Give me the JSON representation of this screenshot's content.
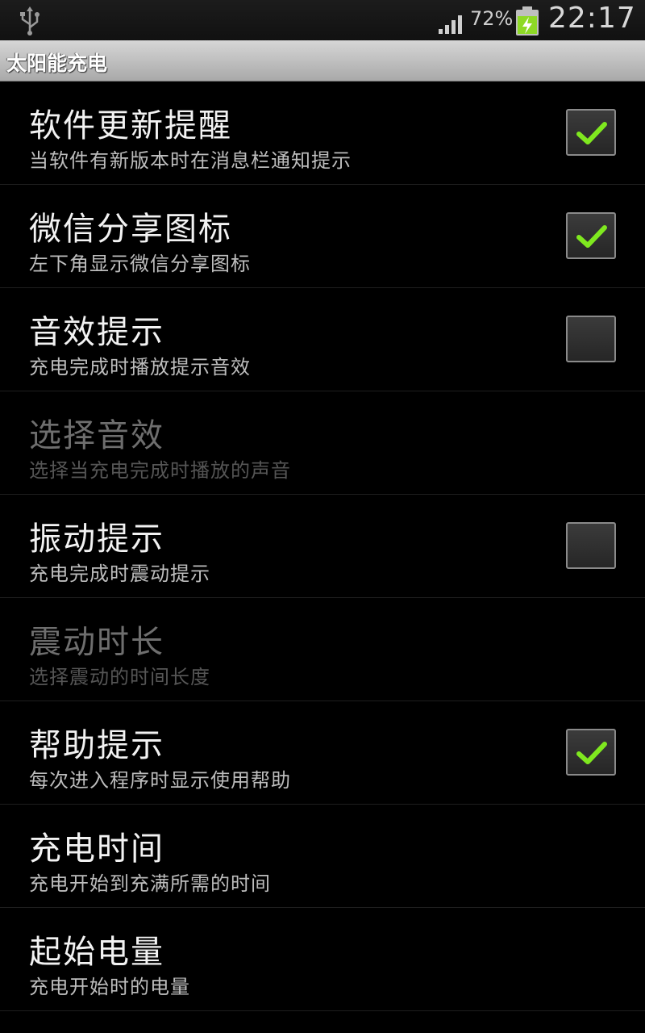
{
  "status_bar": {
    "battery_percent": "72%",
    "time": "22:17"
  },
  "app": {
    "title": "太阳能充电"
  },
  "settings": [
    {
      "title": "软件更新提醒",
      "summary": "当软件有新版本时在消息栏通知提示",
      "checked": true,
      "has_checkbox": true,
      "enabled": true
    },
    {
      "title": "微信分享图标",
      "summary": "左下角显示微信分享图标",
      "checked": true,
      "has_checkbox": true,
      "enabled": true
    },
    {
      "title": "音效提示",
      "summary": "充电完成时播放提示音效",
      "checked": false,
      "has_checkbox": true,
      "enabled": true
    },
    {
      "title": "选择音效",
      "summary": "选择当充电完成时播放的声音",
      "has_checkbox": false,
      "enabled": false
    },
    {
      "title": "振动提示",
      "summary": "充电完成时震动提示",
      "checked": false,
      "has_checkbox": true,
      "enabled": true
    },
    {
      "title": "震动时长",
      "summary": "选择震动的时间长度",
      "has_checkbox": false,
      "enabled": false
    },
    {
      "title": "帮助提示",
      "summary": "每次进入程序时显示使用帮助",
      "checked": true,
      "has_checkbox": true,
      "enabled": true
    },
    {
      "title": "充电时间",
      "summary": "充电开始到充满所需的时间",
      "has_checkbox": false,
      "enabled": true
    },
    {
      "title": "起始电量",
      "summary": "充电开始时的电量",
      "has_checkbox": false,
      "enabled": true
    }
  ],
  "colors": {
    "check_mark": "#7fe81f",
    "battery_fill": "#8ed926"
  },
  "icons": [
    "usb-icon",
    "signal-icon",
    "battery-charging-icon",
    "check-icon"
  ]
}
